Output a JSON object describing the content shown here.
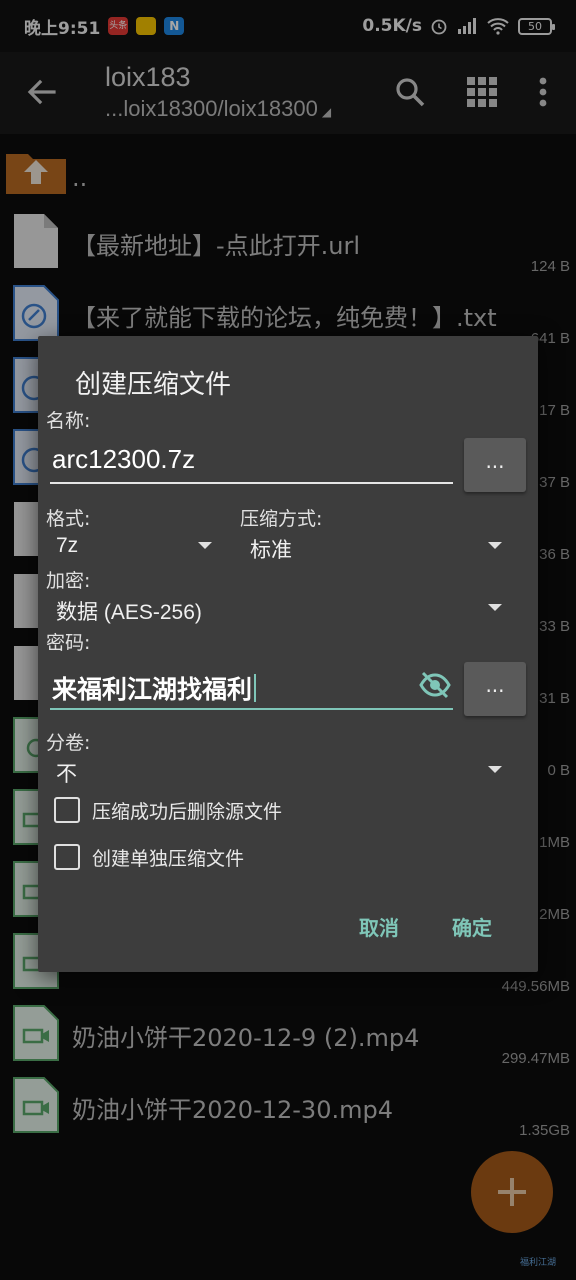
{
  "status_bar": {
    "time": "晚上9:51",
    "badge1": "头条",
    "network_speed": "0.5K/s",
    "battery": "50"
  },
  "app_bar": {
    "title": "loix183",
    "path": "...loix18300/loix18300"
  },
  "files": [
    {
      "name": "..",
      "size": ""
    },
    {
      "name": "【最新地址】-点此打开.url",
      "size": "124 B"
    },
    {
      "name": "【来了就能下载的论坛，纯免费！】.txt",
      "size": "641 B"
    },
    {
      "name": "",
      "size": "17 B"
    },
    {
      "name": "",
      "size": "37 B"
    },
    {
      "name": "",
      "size": "36 B"
    },
    {
      "name": "",
      "size": "33 B"
    },
    {
      "name": "",
      "size": "31 B"
    },
    {
      "name": "",
      "size": "0 B"
    },
    {
      "name": "",
      "size": "1MB"
    },
    {
      "name": "",
      "size": "2MB"
    },
    {
      "name": "",
      "size": "449.56MB"
    },
    {
      "name": "奶油小饼干2020-12-9 (2).mp4",
      "size": "299.47MB"
    },
    {
      "name": "奶油小饼干2020-12-30.mp4",
      "size": "1.35GB"
    }
  ],
  "dialog": {
    "title": "创建压缩文件",
    "name_label": "名称:",
    "name_value": "arc12300.7z",
    "browse_label": "...",
    "format_label": "格式:",
    "format_value": "7z",
    "method_label": "压缩方式:",
    "method_value": "标准",
    "encryption_label": "加密:",
    "encryption_value": "数据 (AES-256)",
    "password_label": "密码:",
    "password_value": "来福利江湖找福利",
    "password_browse_label": "...",
    "volume_label": "分卷:",
    "volume_value": "不",
    "checkbox_delete": "压缩成功后删除源文件",
    "checkbox_separate": "创建单独压缩文件",
    "cancel": "取消",
    "ok": "确定"
  },
  "watermark": "福利江湖"
}
